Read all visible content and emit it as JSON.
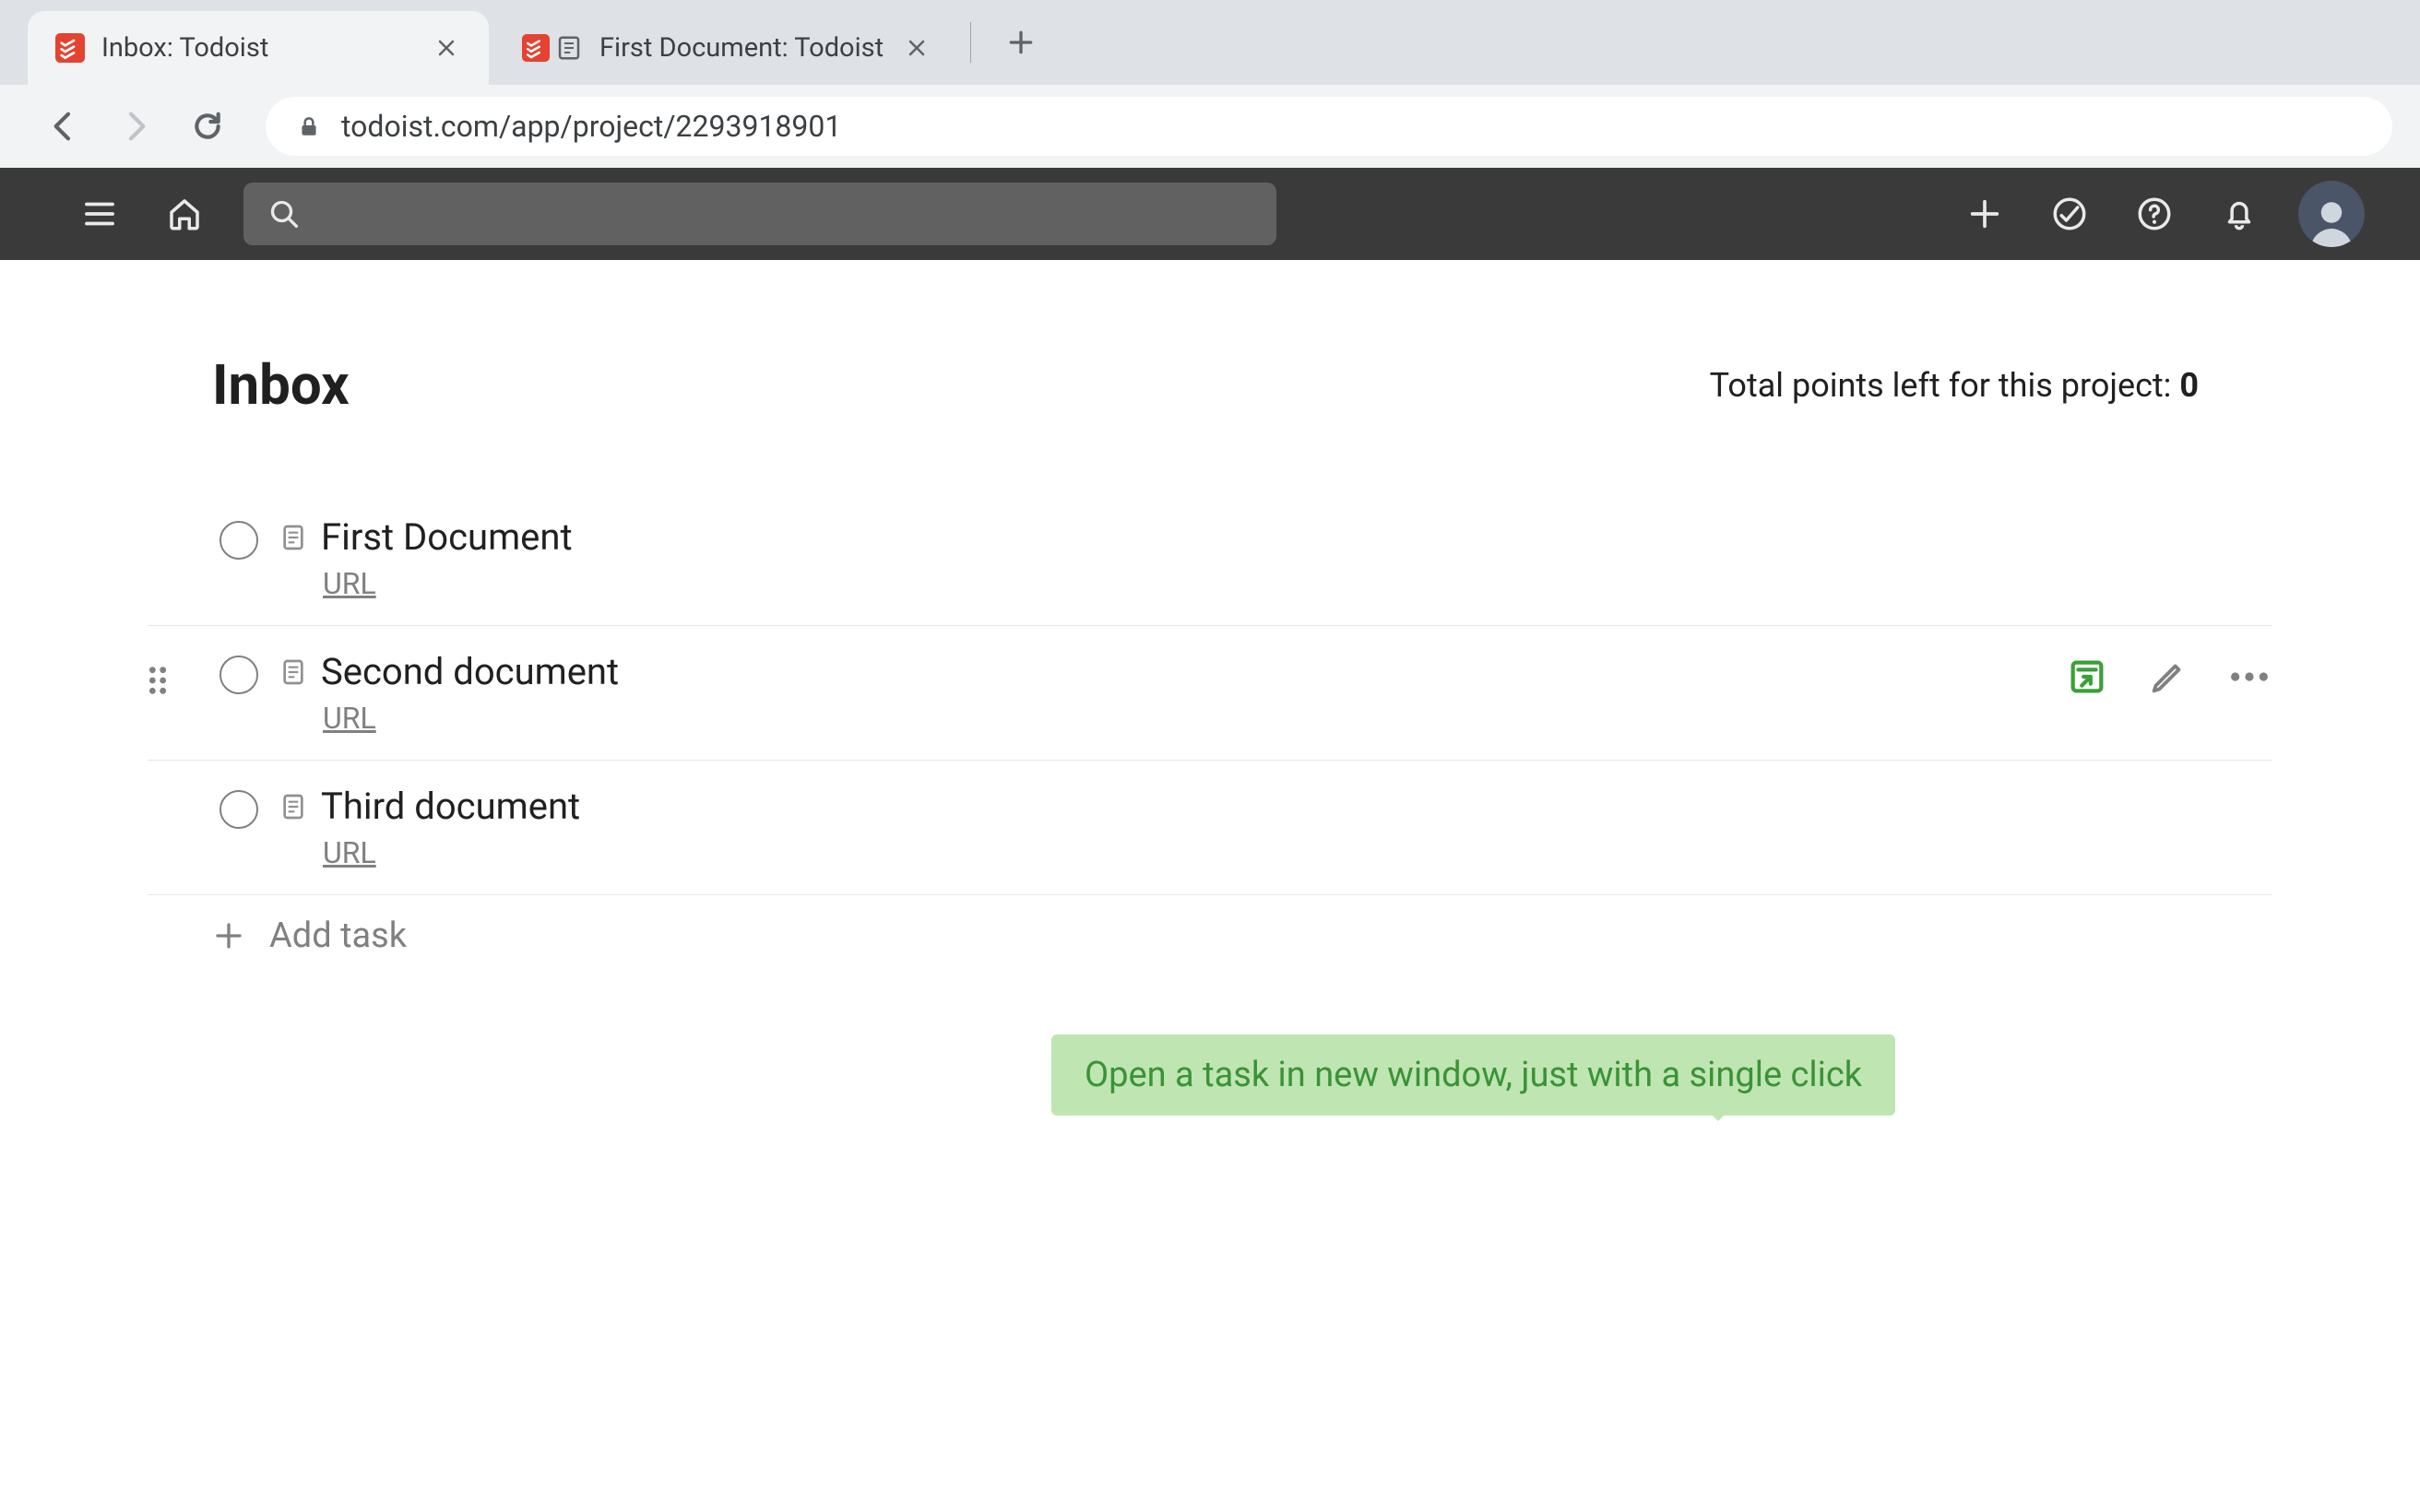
{
  "browser": {
    "tabs": [
      {
        "title": "Inbox: Todoist",
        "active": true
      },
      {
        "title": "First Document: Todoist",
        "active": false
      }
    ],
    "url": "todoist.com/app/project/2293918901"
  },
  "topbar": {},
  "page": {
    "title": "Inbox",
    "points_prefix": "Total points left for this project: ",
    "points_value": "0"
  },
  "tasks": [
    {
      "title": "First Document",
      "sub": "URL",
      "hover": false
    },
    {
      "title": "Second document",
      "sub": "URL",
      "hover": true
    },
    {
      "title": "Third document",
      "sub": "URL",
      "hover": false
    }
  ],
  "add_task_label": "Add task",
  "tooltip": "Open a task in new window, just with a single click"
}
